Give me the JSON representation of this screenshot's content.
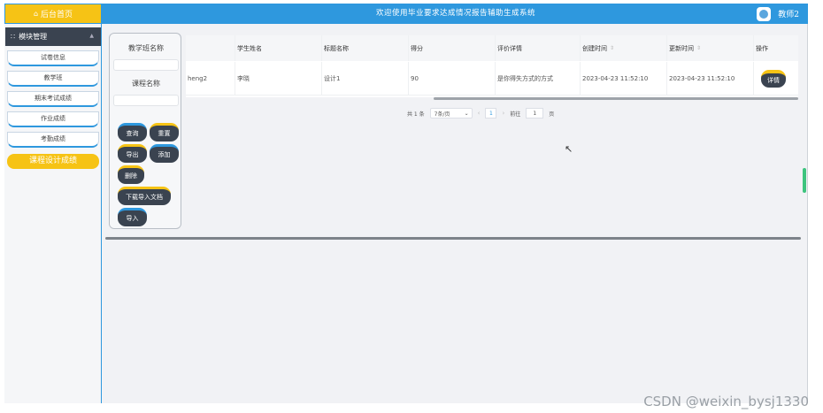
{
  "topbar": {
    "home_label": "后台首页",
    "title": "欢迎使用毕业要求达成情况报告辅助生成系统",
    "user_name": "教师2"
  },
  "sidebar": {
    "section_label": "模块管理",
    "items": [
      {
        "label": "试卷信息"
      },
      {
        "label": "教学班"
      },
      {
        "label": "期末考试成绩"
      },
      {
        "label": "作业成绩"
      },
      {
        "label": "考勤成绩"
      },
      {
        "label": "课程设计成绩"
      }
    ],
    "active_index": 5
  },
  "search": {
    "class_label": "教学班名称",
    "class_value": "",
    "course_label": "课程名称",
    "course_value": "",
    "buttons": {
      "query": "查询",
      "reset": "重置",
      "export": "导出",
      "add": "添加",
      "delete": "删除",
      "download_template": "下载导入文档",
      "import": "导入"
    }
  },
  "table": {
    "headers": [
      "",
      "学生姓名",
      "标题名称",
      "得分",
      "评价详情",
      "创建时间",
      "更新时间",
      "操作"
    ],
    "rows": [
      {
        "c0": "heng2",
        "c1": "李晓",
        "c2": "设计1",
        "c3": "90",
        "c4": "是你得失方式的方式",
        "c5": "2023-04-23 11:52:10",
        "c6": "2023-04-23 11:52:10",
        "action": "详情"
      }
    ]
  },
  "pagination": {
    "total": "共 1 条",
    "page_size": "7条/页",
    "current_page": "1",
    "goto_label": "前往",
    "goto_value": "1",
    "page_unit": "页"
  },
  "watermark": "CSDN @weixin_bysj1330",
  "colors": {
    "primary": "#2e98de",
    "accent": "#f6c315",
    "dark": "#3a4350"
  }
}
